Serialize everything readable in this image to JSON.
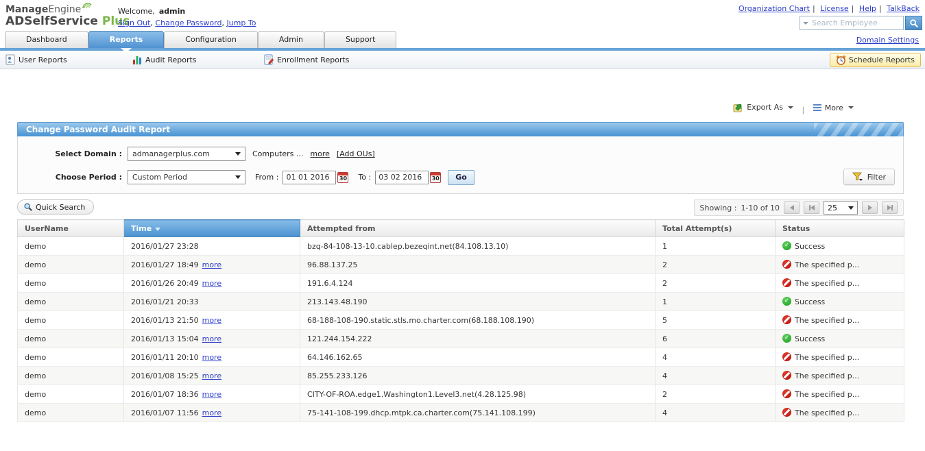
{
  "brand": {
    "manage": "Manage",
    "engine": "Engine",
    "product": "ADSelfService",
    "product_accent": "Plus",
    "welcome_label": "Welcome,",
    "username": "admin",
    "session_links": [
      "Sign Out",
      "Change Password",
      "Jump To"
    ]
  },
  "top_right": {
    "links": [
      "Organization Chart",
      "License",
      "Help",
      "TalkBack"
    ],
    "search_placeholder": "Search Employee",
    "domain_settings_link": "Domain Settings"
  },
  "tabs": [
    {
      "label": "Dashboard",
      "active": false
    },
    {
      "label": "Reports",
      "active": true
    },
    {
      "label": "Configuration",
      "active": false
    },
    {
      "label": "Admin",
      "active": false
    },
    {
      "label": "Support",
      "active": false
    }
  ],
  "subnav": {
    "items": [
      "User Reports",
      "Audit Reports",
      "Enrollment Reports"
    ],
    "schedule_button": "Schedule Reports"
  },
  "toolbar": {
    "export_as_label": "Export As",
    "more_label": "More"
  },
  "report": {
    "title": "Change Password Audit Report",
    "select_domain_label": "Select Domain :",
    "domain_value": "admanagerplus.com",
    "computers_text": "Computers ...",
    "more_link": "more",
    "add_ous_link": "[Add OUs]",
    "choose_period_label": "Choose Period :",
    "period_value": "Custom Period",
    "from_label": "From :",
    "from_value": "01 01 2016",
    "to_label": "To :",
    "to_value": "03 02 2016",
    "calendar_day": "30",
    "go_button": "Go",
    "filter_button": "Filter"
  },
  "listing": {
    "quick_search_button": "Quick Search",
    "showing_label": "Showing :",
    "showing_range": "1-10 of 10",
    "page_size": "25"
  },
  "table": {
    "columns": [
      "UserName",
      "Time",
      "Attempted from",
      "Total Attempt(s)",
      "Status"
    ],
    "sorted_column": "Time",
    "more_link": "more",
    "rows": [
      {
        "user": "demo",
        "time": "2016/01/27 23:28",
        "more": false,
        "from": "bzq-84-108-13-10.cablep.bezeqint.net(84.108.13.10)",
        "attempts": "1",
        "status": "Success",
        "ok": true
      },
      {
        "user": "demo",
        "time": "2016/01/27 18:49",
        "more": true,
        "from": "96.88.137.25",
        "attempts": "2",
        "status": "The specified p...",
        "ok": false
      },
      {
        "user": "demo",
        "time": "2016/01/26 20:49",
        "more": true,
        "from": "191.6.4.124",
        "attempts": "2",
        "status": "The specified p...",
        "ok": false
      },
      {
        "user": "demo",
        "time": "2016/01/21 20:33",
        "more": false,
        "from": "213.143.48.190",
        "attempts": "1",
        "status": "Success",
        "ok": true
      },
      {
        "user": "demo",
        "time": "2016/01/13 21:50",
        "more": true,
        "from": "68-188-108-190.static.stls.mo.charter.com(68.188.108.190)",
        "attempts": "5",
        "status": "The specified p...",
        "ok": false
      },
      {
        "user": "demo",
        "time": "2016/01/13 15:04",
        "more": true,
        "from": "121.244.154.222",
        "attempts": "6",
        "status": "Success",
        "ok": true
      },
      {
        "user": "demo",
        "time": "2016/01/11 20:10",
        "more": true,
        "from": "64.146.162.65",
        "attempts": "4",
        "status": "The specified p...",
        "ok": false
      },
      {
        "user": "demo",
        "time": "2016/01/08 15:25",
        "more": true,
        "from": "85.255.233.126",
        "attempts": "4",
        "status": "The specified p...",
        "ok": false
      },
      {
        "user": "demo",
        "time": "2016/01/07 18:36",
        "more": true,
        "from": "CITY-OF-ROA.edge1.Washington1.Level3.net(4.28.125.98)",
        "attempts": "2",
        "status": "The specified p...",
        "ok": false
      },
      {
        "user": "demo",
        "time": "2016/01/07 11:56",
        "more": true,
        "from": "75-141-108-199.dhcp.mtpk.ca.charter.com(75.141.108.199)",
        "attempts": "4",
        "status": "The specified p...",
        "ok": false
      }
    ]
  },
  "colors": {
    "brand_green": "#7ab648",
    "link_blue": "#2d3ecb",
    "active_tab_blue": "#5093d2",
    "header_bar_blue": "#4792d3",
    "success_green": "#1f9a1f",
    "error_red": "#b50d0d",
    "schedule_button_yellow": "#fcedaa"
  }
}
